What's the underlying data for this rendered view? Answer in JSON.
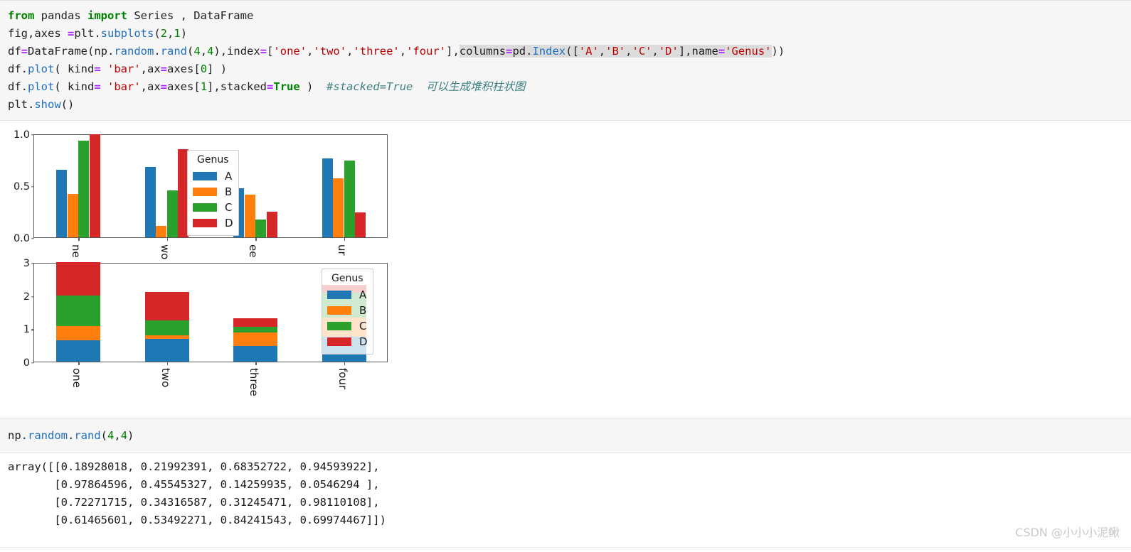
{
  "notebook": {
    "cell1": {
      "lines": [
        "from pandas import Series , DataFrame",
        "fig,axes =plt.subplots(2,1)",
        "df=DataFrame(np.random.rand(4,4),index=['one','two','three','four'],columns=pd.Index(['A','B','C','D'],name='Genus'))",
        "df.plot( kind= 'bar',ax=axes[0] )",
        "df.plot( kind= 'bar',ax=axes[1],stacked=True )  #stacked=True 可以生成堆积柱状图",
        "plt.show()"
      ],
      "tokens": {
        "l1_from": "from",
        "l1_pandas": " pandas ",
        "l1_import": "import",
        "l1_rest": " Series , DataFrame",
        "l2_a": "fig,axes ",
        "l2_eq": "=",
        "l2_b": "plt.",
        "l2_subplots": "subplots",
        "l2_p1": "(",
        "l2_2": "2",
        "l2_c": ",",
        "l2_1": "1",
        "l2_p2": ")",
        "l3_df": "df",
        "l3_eq": "=",
        "l3_DataFrame": "DataFrame(np.",
        "l3_random": "random",
        "l3_dot": ".",
        "l3_rand": "rand",
        "l3_op": "(",
        "l3_4a": "4",
        "l3_comma": ",",
        "l3_4b": "4",
        "l3_cp": "),index",
        "l3_eq2": "=",
        "l3_br": "[",
        "l3_one": "'one'",
        "l3_c1": ",",
        "l3_two": "'two'",
        "l3_c2": ",",
        "l3_three": "'three'",
        "l3_c3": ",",
        "l3_four": "'four'",
        "l3_brc": "],",
        "l3_columns": "columns",
        "l3_eq3": "=",
        "l3_pd": "pd.",
        "l3_Index": "Index",
        "l3_op2": "([",
        "l3_A": "'A'",
        "l3_cc1": ",",
        "l3_B": "'B'",
        "l3_cc2": ",",
        "l3_C": "'C'",
        "l3_cc3": ",",
        "l3_D": "'D'",
        "l3_cl": "],name",
        "l3_eq4": "=",
        "l3_Genus": "'Genus'",
        "l3_end": ")",
        "l3_end2": ")",
        "l4_df": "df.",
        "l4_plot": "plot",
        "l4_op": "( kind",
        "l4_eq": "=",
        "l4_bar": " 'bar'",
        "l4_ax": ",ax",
        "l4_eq2": "=",
        "l4_axes": "axes[",
        "l4_0": "0",
        "l4_cl": "] )",
        "l5_df": "df.",
        "l5_plot": "plot",
        "l5_op": "( kind",
        "l5_eq": "=",
        "l5_bar": " 'bar'",
        "l5_ax": ",ax",
        "l5_eq2": "=",
        "l5_axes": "axes[",
        "l5_1": "1",
        "l5_cl": "],stacked",
        "l5_eq3": "=",
        "l5_True": "True",
        "l5_cl2": " )",
        "l5_comment": "#stacked=True",
        "l5_cn": "可以生成堆积柱状图",
        "l6_plt": "plt.",
        "l6_show": "show",
        "l6_op": "()"
      }
    },
    "cell2": {
      "tokens": {
        "np": "np.",
        "random": "random",
        "dot": ".",
        "rand": "rand",
        "op": "(",
        "n1": "4",
        "comma": ",",
        "n2": "4",
        "cp": ")"
      }
    },
    "output": {
      "text": "array([[0.18928018, 0.21992391, 0.68352722, 0.94593922],\n       [0.97864596, 0.45545327, 0.14259935, 0.0546294 ],\n       [0.72271715, 0.34316587, 0.31245471, 0.98110108],\n       [0.61465601, 0.53492271, 0.84241543, 0.69974467]])"
    }
  },
  "watermark": {
    "text": "CSDN @小小小泥鳅"
  },
  "chart_data": [
    {
      "type": "bar",
      "subplot": "axes[0]",
      "title": "",
      "stacked": false,
      "categories": [
        "one",
        "two",
        "three",
        "four"
      ],
      "series": [
        {
          "name": "A",
          "color": "#1f77b4",
          "values": [
            0.65,
            0.68,
            0.47,
            0.76
          ]
        },
        {
          "name": "B",
          "color": "#ff7f0e",
          "values": [
            0.42,
            0.11,
            0.41,
            0.57
          ]
        },
        {
          "name": "C",
          "color": "#2ca02c",
          "values": [
            0.93,
            0.45,
            0.17,
            0.74
          ]
        },
        {
          "name": "D",
          "color": "#d62728",
          "values": [
            0.99,
            0.85,
            0.25,
            0.24
          ]
        }
      ],
      "legend": {
        "title": "Genus",
        "entries": [
          "A",
          "B",
          "C",
          "D"
        ],
        "position": "upper center"
      },
      "xlabel": "",
      "ylabel": "",
      "ylim": [
        0.0,
        1.0
      ],
      "yticks": [
        "0.0",
        "0.5",
        "1.0"
      ],
      "ytick_values": [
        0.0,
        0.5,
        1.0
      ],
      "grid": false,
      "xtick_labels_clipped": [
        "ne",
        "wo",
        "ee",
        "ur"
      ]
    },
    {
      "type": "bar",
      "subplot": "axes[1]",
      "title": "",
      "stacked": true,
      "categories": [
        "one",
        "two",
        "three",
        "four"
      ],
      "series": [
        {
          "name": "A",
          "color": "#1f77b4",
          "values": [
            0.65,
            0.68,
            0.47,
            0.76
          ]
        },
        {
          "name": "B",
          "color": "#ff7f0e",
          "values": [
            0.42,
            0.11,
            0.41,
            0.57
          ]
        },
        {
          "name": "C",
          "color": "#2ca02c",
          "values": [
            0.93,
            0.45,
            0.17,
            0.74
          ]
        },
        {
          "name": "D",
          "color": "#d62728",
          "values": [
            0.99,
            0.85,
            0.25,
            0.24
          ]
        }
      ],
      "totals": [
        2.99,
        2.09,
        1.3,
        2.31
      ],
      "legend": {
        "title": "Genus",
        "entries": [
          "A",
          "B",
          "C",
          "D"
        ],
        "position": "upper right"
      },
      "xlabel": "",
      "ylabel": "",
      "ylim": [
        0,
        3
      ],
      "yticks": [
        "0",
        "1",
        "2",
        "3"
      ],
      "ytick_values": [
        0,
        1,
        2,
        3
      ],
      "grid": false
    }
  ]
}
